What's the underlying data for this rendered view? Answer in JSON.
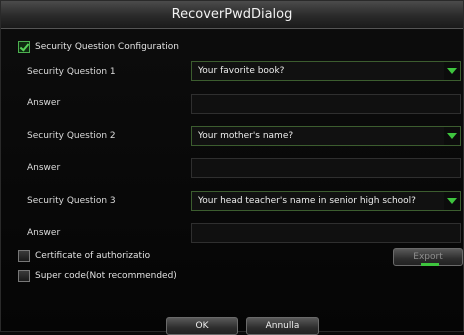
{
  "dialog": {
    "title": "RecoverPwdDialog"
  },
  "security_config": {
    "label": "Security Question Configuration",
    "checked": true
  },
  "questions": [
    {
      "label": "Security Question 1",
      "value": "Your favorite book?",
      "answer_label": "Answer",
      "answer": ""
    },
    {
      "label": "Security Question 2",
      "value": "Your mother's name?",
      "answer_label": "Answer",
      "answer": ""
    },
    {
      "label": "Security Question 3",
      "value": "Your head teacher's name in senior high school?",
      "answer_label": "Answer",
      "answer": ""
    }
  ],
  "certificate": {
    "label": "Certificate of authorizatio",
    "checked": false
  },
  "export_button": {
    "label": "Export"
  },
  "super_code": {
    "label": "Super code(Not recommended)",
    "checked": false
  },
  "buttons": {
    "ok": "OK",
    "cancel": "Annulla"
  },
  "colors": {
    "accent_green": "#3ec53e",
    "combo_border": "#3c5d2f"
  }
}
